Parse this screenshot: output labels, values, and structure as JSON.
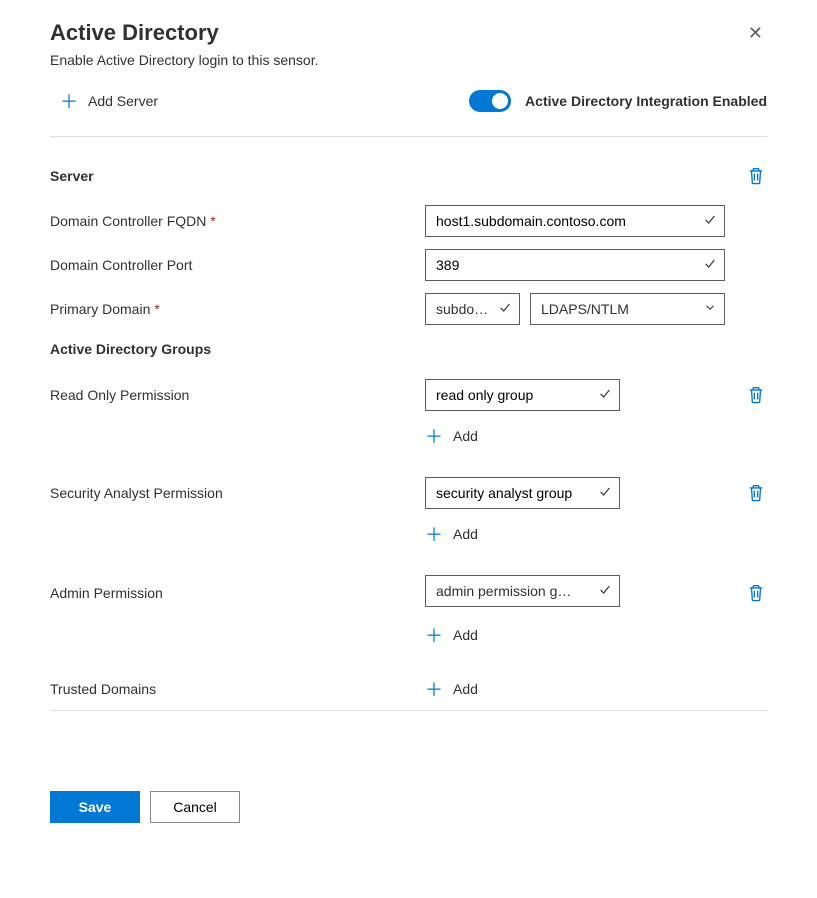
{
  "header": {
    "title": "Active Directory",
    "subtitle": "Enable Active Directory login to this sensor."
  },
  "topControls": {
    "addServer": "Add Server",
    "toggleLabel": "Active Directory Integration Enabled",
    "toggleEnabled": true
  },
  "server": {
    "sectionLabel": "Server",
    "fqdnLabel": "Domain Controller FQDN",
    "fqdnValue": "host1.subdomain.contoso.com",
    "portLabel": "Domain Controller Port",
    "portValue": "389",
    "primaryDomainLabel": "Primary Domain",
    "primaryDomainValue": "subdo…",
    "authValue": "LDAPS/NTLM"
  },
  "groups": {
    "heading": "Active Directory Groups",
    "addLabel": "Add",
    "readOnly": {
      "label": "Read Only Permission",
      "value": "read only group"
    },
    "securityAnalyst": {
      "label": "Security Analyst Permission",
      "value": "security analyst group"
    },
    "admin": {
      "label": "Admin Permission",
      "value": "admin permission g…"
    },
    "trusted": {
      "label": "Trusted Domains"
    }
  },
  "footer": {
    "save": "Save",
    "cancel": "Cancel"
  }
}
